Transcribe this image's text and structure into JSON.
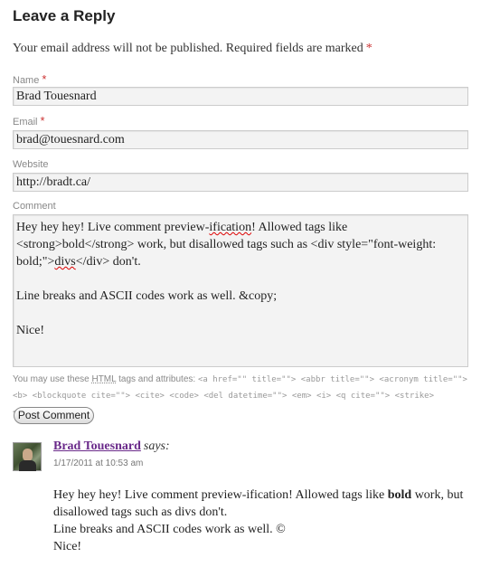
{
  "reply": {
    "title": "Leave a Reply",
    "notes": "Your email address will not be published. Required fields are marked",
    "required_marker": "*"
  },
  "form": {
    "name_label": "Name",
    "name_value": "Brad Touesnard",
    "email_label": "Email",
    "email_value": "brad@touesnard.com",
    "website_label": "Website",
    "website_value": "http://bradt.ca/",
    "comment_label": "Comment",
    "comment_line1_pre": "Hey hey hey! Live comment preview-",
    "comment_line1_spell": "ification",
    "comment_line1_post": "! Allowed tags like <strong>bold</strong> work, but disallowed tags such as <div style=\"font-weight: bold;\">",
    "comment_divs_spell": "divs",
    "comment_line1_end": "</div> don't.",
    "comment_line2": "Line breaks and ASCII codes work as well. &copy;",
    "comment_line3": "Nice!",
    "allowed_prefix": "You may use these",
    "allowed_abbr": "HTML",
    "allowed_mid": "tags and attributes:",
    "allowed_tags": "<a href=\"\" title=\"\"> <abbr title=\"\"> <acronym title=\"\"> <b> <blockquote cite=\"\"> <cite> <code> <del datetime=\"\"> <em> <i> <q cite=\"\"> <strike> <strong>",
    "submit_label": "Post Comment"
  },
  "comment": {
    "author": "Brad Touesnard",
    "says": "says:",
    "date": "1/17/2011 at 10:53 am",
    "line1_pre": "Hey hey hey! Live comment preview-ification! Allowed tags like",
    "line1_bold": "bold",
    "line1_post": "work, but disallowed tags such as divs don't.",
    "line2": "Line breaks and ASCII codes work as well. ©",
    "line3": "Nice!"
  },
  "colors": {
    "required": "#cc3333",
    "author_link": "#6a2a8a"
  },
  "icons": {
    "avatar": "user-avatar-photo"
  }
}
